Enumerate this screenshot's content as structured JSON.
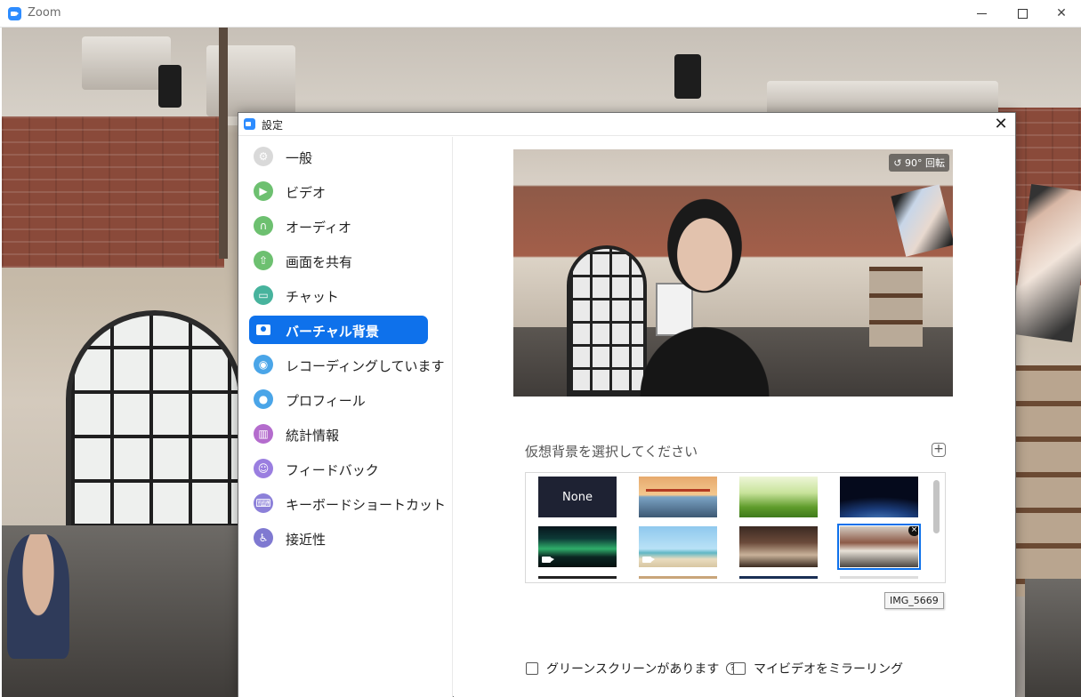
{
  "window": {
    "title": "Zoom",
    "controls": {
      "minimize": "—",
      "maximize": "☐",
      "close": "✕"
    }
  },
  "dialog": {
    "title": "設定",
    "close": "✕"
  },
  "sidebar": {
    "items": [
      {
        "label": "一般",
        "icon": "gear-icon",
        "color": "#d9d9d9"
      },
      {
        "label": "ビデオ",
        "icon": "video-icon",
        "color": "#6dc070"
      },
      {
        "label": "オーディオ",
        "icon": "headphones-icon",
        "color": "#6dc070"
      },
      {
        "label": "画面を共有",
        "icon": "share-screen-icon",
        "color": "#6dc070"
      },
      {
        "label": "チャット",
        "icon": "chat-icon",
        "color": "#47b39d"
      },
      {
        "label": "バーチャル背景",
        "icon": "virtual-background-icon",
        "color": "#0e71eb",
        "active": true
      },
      {
        "label": "レコーディングしています",
        "icon": "record-icon",
        "color": "#4aa5e8"
      },
      {
        "label": "プロフィール",
        "icon": "profile-icon",
        "color": "#4aa5e8"
      },
      {
        "label": "統計情報",
        "icon": "statistics-icon",
        "color": "#b46ccd"
      },
      {
        "label": "フィードバック",
        "icon": "feedback-icon",
        "color": "#9a7ee0"
      },
      {
        "label": "キーボードショートカット",
        "icon": "keyboard-icon",
        "color": "#8c80d9"
      },
      {
        "label": "接近性",
        "icon": "accessibility-icon",
        "color": "#7f79d1"
      }
    ]
  },
  "preview": {
    "rotate_label": "90° 回転"
  },
  "backgrounds": {
    "heading": "仮想背景を選択してください",
    "add_label": "+",
    "none_label": "None",
    "remove_label": "×",
    "tooltip": "IMG_5669"
  },
  "options": {
    "green_screen_label": "グリーンスクリーンがあります",
    "help_label": "?",
    "mirror_label": "マイビデオをミラーリング"
  }
}
